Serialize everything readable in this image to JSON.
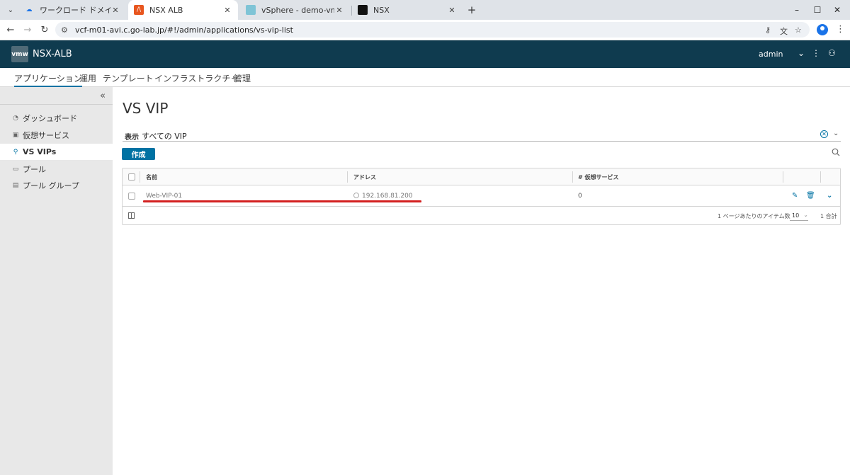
{
  "browser": {
    "tabs": [
      {
        "title": "ワークロード ドメイン - サマリ",
        "favicon": "cloud-icon",
        "active": false
      },
      {
        "title": "NSX ALB",
        "favicon": "avi-icon",
        "active": true
      },
      {
        "title": "vSphere - demo-vm - 仮想マシン",
        "favicon": "vsphere-icon",
        "active": false
      },
      {
        "title": "NSX",
        "favicon": "nsx-icon",
        "active": false
      }
    ],
    "close_glyph": "✕",
    "new_tab_glyph": "+",
    "url": "vcf-m01-avi.c.go-lab.jp/#!/admin/applications/vs-vip-list"
  },
  "app": {
    "logo": "vmw",
    "brand": "NSX-ALB",
    "user": "admin",
    "primary_nav": [
      "アプリケーション",
      "運用",
      "テンプレート",
      "インフラストラクチャ",
      "管理"
    ],
    "active_nav_index": 0
  },
  "sidebar": {
    "items": [
      {
        "label": "ダッシュボード",
        "icon": "dashboard-icon",
        "active": false
      },
      {
        "label": "仮想サービス",
        "icon": "virtual-service-icon",
        "active": false
      },
      {
        "label": "VS VIPs",
        "icon": "location-pin-icon",
        "active": true
      },
      {
        "label": "プール",
        "icon": "pool-icon",
        "active": false
      },
      {
        "label": "プール グループ",
        "icon": "pool-group-icon",
        "active": false
      }
    ]
  },
  "main": {
    "title": "VS VIP",
    "filter": {
      "label": "表示",
      "value": "すべての VIP"
    },
    "create_label": "作成",
    "grid": {
      "columns": [
        "名前",
        "アドレス",
        "# 仮想サービス"
      ],
      "rows": [
        {
          "name": "Web-VIP-01",
          "address": "192.168.81.200",
          "virtual_services": "0"
        }
      ],
      "footer": {
        "items_per_page_label": "1 ページあたりのアイテム数",
        "page_size": "10",
        "total": "1 合計"
      }
    }
  },
  "colors": {
    "header_bg": "#0f3b4f",
    "accent": "#0072a3",
    "highlight_line": "#d32020"
  }
}
